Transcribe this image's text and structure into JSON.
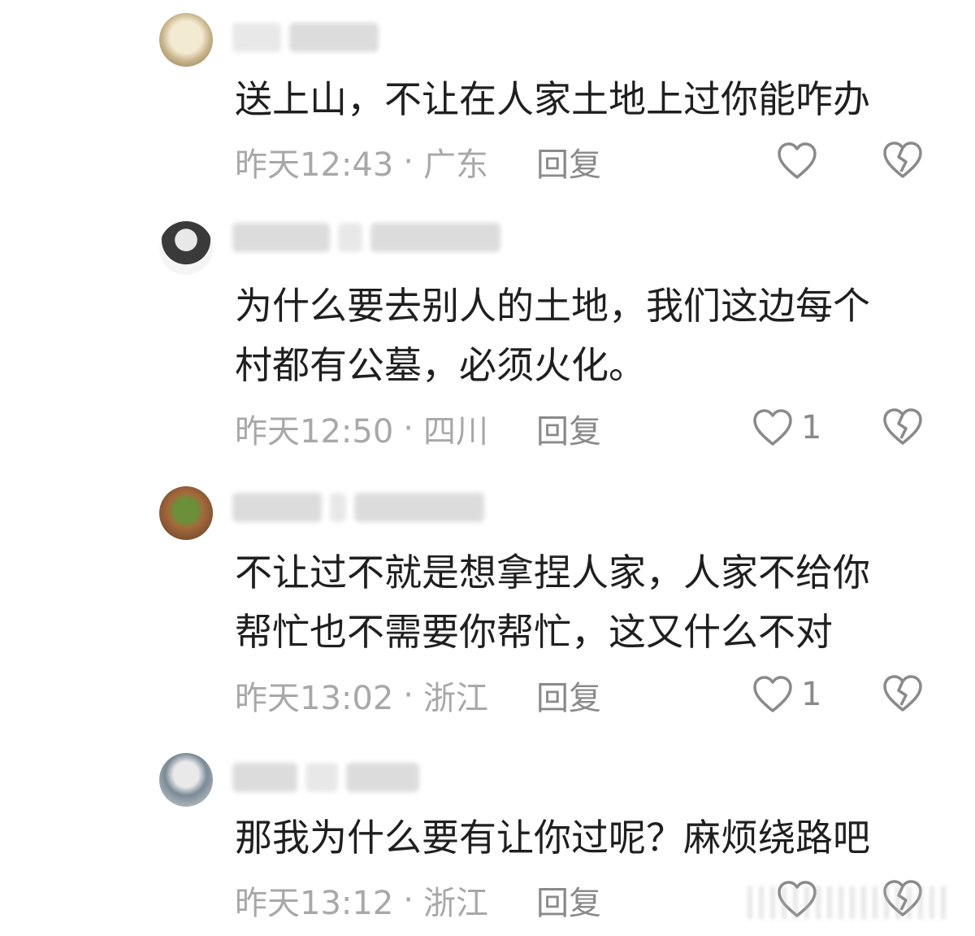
{
  "comments": [
    {
      "text": "送上山，不让在人家土地上过你能咋办",
      "time": "昨天12:43",
      "location": "广东",
      "reply_label": "回复",
      "likes": ""
    },
    {
      "text": "为什么要去别人的土地，我们这边每个\n村都有公墓，必须火化。",
      "time": "昨天12:50",
      "location": "四川",
      "reply_label": "回复",
      "likes": "1"
    },
    {
      "text": "不让过不就是想拿捏人家，人家不给你\n帮忙也不需要你帮忙，这又什么不对",
      "time": "昨天13:02",
      "location": "浙江",
      "reply_label": "回复",
      "likes": "1"
    },
    {
      "text": "那我为什么要有让你过呢？麻烦绕路吧",
      "time": "昨天13:12",
      "location": "浙江",
      "reply_label": "回复",
      "likes": ""
    }
  ],
  "separator": "·",
  "icons": {
    "like": "heart-outline-icon",
    "dislike": "broken-heart-icon"
  },
  "colors": {
    "text": "#1f1f1f",
    "meta": "#a8a8a8",
    "icon": "#8a8a8a"
  }
}
